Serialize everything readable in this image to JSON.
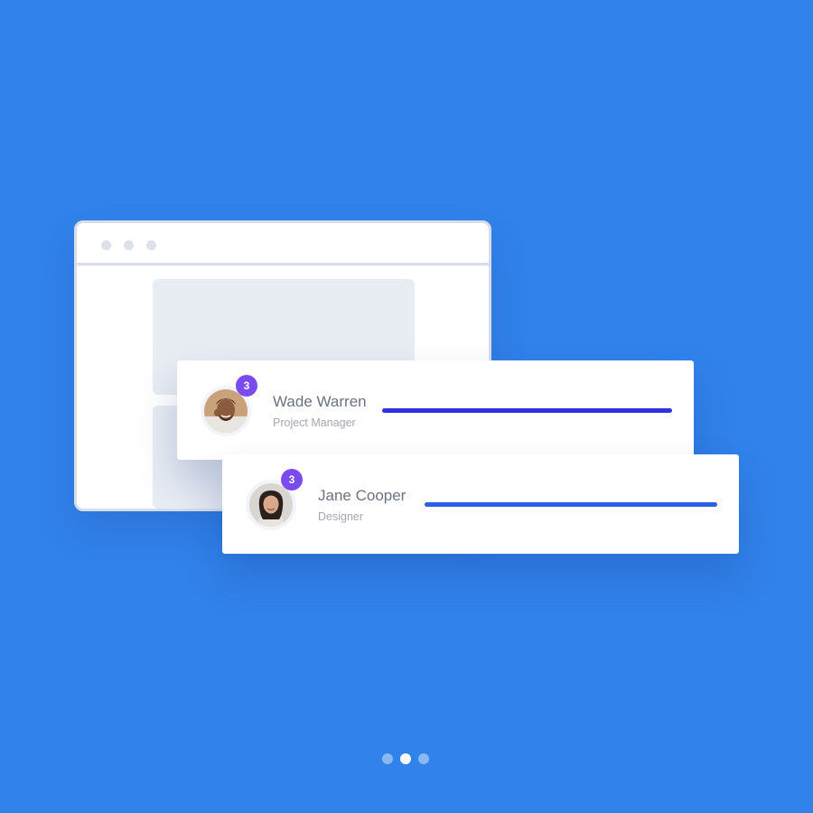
{
  "colors": {
    "background": "#3182eb",
    "badge": "#7a4cf0",
    "pager_active": "#ffffff",
    "pager_inactive": "#8ab8f3"
  },
  "cards": [
    {
      "name": "Wade Warren",
      "role": "Project Manager",
      "badge": "3",
      "progress": 1.0,
      "progress_color": "#3131e4"
    },
    {
      "name": "Jane Cooper",
      "role": "Designer",
      "badge": "3",
      "progress": 1.0,
      "progress_color": "#2d5fe6"
    }
  ],
  "pager": {
    "count": 3,
    "active_index": 1
  }
}
